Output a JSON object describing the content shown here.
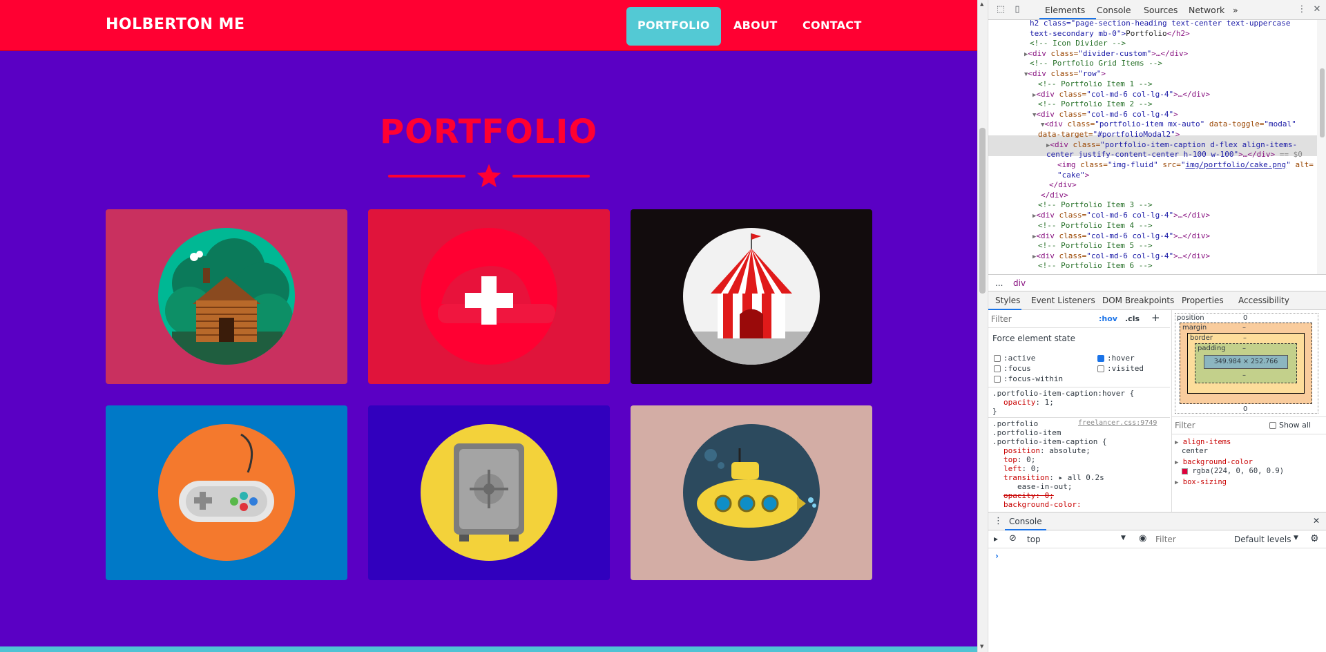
{
  "site": {
    "brand": "HOLBERTON ME",
    "nav": {
      "portfolio": "PORTFOLIO",
      "about": "ABOUT",
      "contact": "CONTACT"
    },
    "heading": "PORTFOLIO",
    "tiles": [
      {
        "name": "cabin",
        "bg": "#c9305f",
        "circle": "#00b894"
      },
      {
        "name": "cake",
        "bg": "#e0143b",
        "circle": "#ff0032"
      },
      {
        "name": "circus",
        "bg": "#120c0d",
        "circle": "#f2f2f2"
      },
      {
        "name": "game",
        "bg": "#0079c7",
        "circle": "#f4792d"
      },
      {
        "name": "safe",
        "bg": "#3100be",
        "circle": "#f3d23a"
      },
      {
        "name": "submarine",
        "bg": "#d3ada5",
        "circle": "#2c4a5e"
      }
    ],
    "colors": {
      "primary": "#ff0032",
      "background": "#5a00c4",
      "accent": "#53c9d4"
    }
  },
  "devtools": {
    "tabs": [
      "Elements",
      "Console",
      "Sources",
      "Network"
    ],
    "more_tabs": "»",
    "dom": {
      "line0": "h2 class=\"page-section-heading text-center text-uppercase",
      "line1_a": "text-secondary mb-0\">",
      "line1_b": "Portfolio",
      "line1_c": "</h2>",
      "c_icon_divider": "<!-- Icon Divider -->",
      "divider_tag": "<div ",
      "divider_attr": "class=",
      "divider_val": "\"divider-custom\"",
      "divider_end": ">…</div>",
      "c_grid": "<!-- Portfolio Grid Items -->",
      "row_val": "\"row\"",
      "c1": "<!-- Portfolio Item 1 -->",
      "col_val": "\"col-md-6 col-lg-4\"",
      "c2": "<!-- Portfolio Item 2 -->",
      "pi_val": "\"portfolio-item mx-auto\"",
      "toggle_attr": "data-toggle=",
      "toggle_val": "\"modal\"",
      "target_attr": "data-target=",
      "target_val": "\"#portfolioModal2\"",
      "cap_val": "\"portfolio-item-caption d-flex align-items-",
      "cap_val2": "center justify-content-center h-100 w-100\"",
      "cap_end": ">…</div>",
      "sel_marker": "== $0",
      "img_class": "\"img-fluid\"",
      "img_src_attr": "src=",
      "img_src": "img/portfolio/cake.png",
      "img_alt_attr": "alt=",
      "img_alt": "\"cake\"",
      "close_div": "</div>",
      "c3": "<!-- Portfolio Item 3 -->",
      "c4": "<!-- Portfolio Item 4 -->",
      "c5": "<!-- Portfolio Item 5 -->",
      "c6": "<!-- Portfolio Item 6 -->"
    },
    "breadcrumb": {
      "ellipsis": "...",
      "item": "div"
    },
    "subtabs": [
      "Styles",
      "Event Listeners",
      "DOM Breakpoints",
      "Properties",
      "Accessibility"
    ],
    "styles": {
      "filter_placeholder": "Filter",
      "hov": ":hov",
      "cls": ".cls",
      "plus": "+",
      "force_state": "Force element state",
      "states": [
        ":active",
        ":hover",
        ":focus",
        ":visited",
        ":focus-within"
      ],
      "rule1_selector": ".portfolio-item-caption:hover {",
      "rule1_prop": "opacity",
      "rule1_val": "1;",
      "close_brace": "}",
      "rule2_sel1": ".portfolio",
      "rule2_sel2": ".portfolio-item",
      "rule2_sel3": ".portfolio-item-caption {",
      "rule2_source": "freelancer.css:9749",
      "p_position": "position",
      "v_position": "absolute;",
      "p_top": "top",
      "v_top": "0;",
      "p_left": "left",
      "v_left": "0;",
      "p_transition": "transition",
      "v_transition": "all 0.2s",
      "v_ease": "ease-in-out;",
      "p_opacity": "opacity: 0;",
      "p_background": "background-color:"
    },
    "box": {
      "position_label": "position",
      "position_val": "0",
      "margin_label": "margin",
      "margin_val": "–",
      "border_label": "border",
      "border_val": "–",
      "padding_label": "padding",
      "padding_val": "–",
      "content": "349.984 × 252.766",
      "side_val": "–",
      "bottom_val": "0",
      "filter_placeholder": "Filter",
      "show_all": "Show all",
      "computed": [
        {
          "prop": "align-items",
          "value": "center"
        },
        {
          "prop": "background-color",
          "value": "rgba(224, 0, 60, 0.9)"
        },
        {
          "prop": "box-sizing",
          "value": ""
        }
      ]
    },
    "console": {
      "title": "Console",
      "context": "top",
      "filter_placeholder": "Filter",
      "levels": "Default levels",
      "prompt": "›"
    }
  }
}
